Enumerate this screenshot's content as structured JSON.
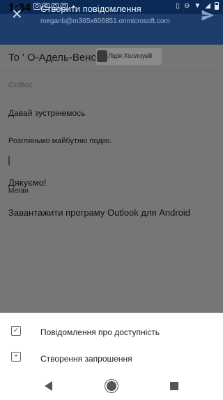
{
  "status_bar": {
    "time": "1:34",
    "app_icons": [
      "outlook-icon",
      "outlook-icon",
      "outlook-icon",
      "outlook-icon"
    ],
    "app_icon_letter": "O"
  },
  "app_bar": {
    "title": "Створити повідомлення",
    "account": "meganb@m365x606851.onmicrosoft.com"
  },
  "compose": {
    "to_label": "To ' О-Адель-Венс",
    "recipient_chip": "Лідія Холлоуей",
    "cc_bcc": "Cc/Bcc",
    "subject": "Давай зустрінемось",
    "body_line": "Розгляньмо майбутню подію.",
    "signature_thanks": "Дякуємо!",
    "signature_name": "Меган",
    "outlook_promo": "Завантажити програму Outlook для Android"
  },
  "bottom_sheet": {
    "items": [
      {
        "label": "Повідомлення про доступність",
        "icon": "checkbox-icon"
      },
      {
        "label": "Створення запрошення",
        "icon": "add-box-icon"
      }
    ]
  },
  "colors": {
    "status_bar": "#0b2a55",
    "app_bar": "#1e3d6b",
    "dim_overlay": "#767676"
  }
}
